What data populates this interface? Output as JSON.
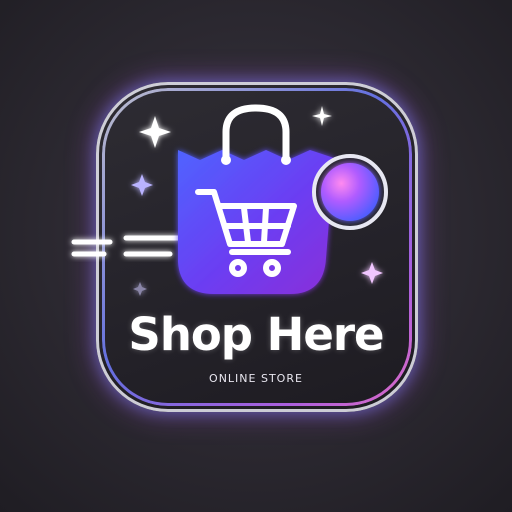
{
  "brand": {
    "title": "Shop Here",
    "subtitle": "ONLINE STORE"
  },
  "icons": {
    "bag": "shopping-bag-icon",
    "cart": "shopping-cart-icon",
    "orb": "gradient-orb-icon",
    "sparkle": "sparkle-icon",
    "motion": "motion-lines-icon"
  },
  "colors": {
    "gradient_blue": "#5a6bff",
    "gradient_purple": "#8a3bf5",
    "gradient_pink": "#e35cff",
    "frame_light": "#e6e6f0",
    "text": "#ffffff"
  }
}
